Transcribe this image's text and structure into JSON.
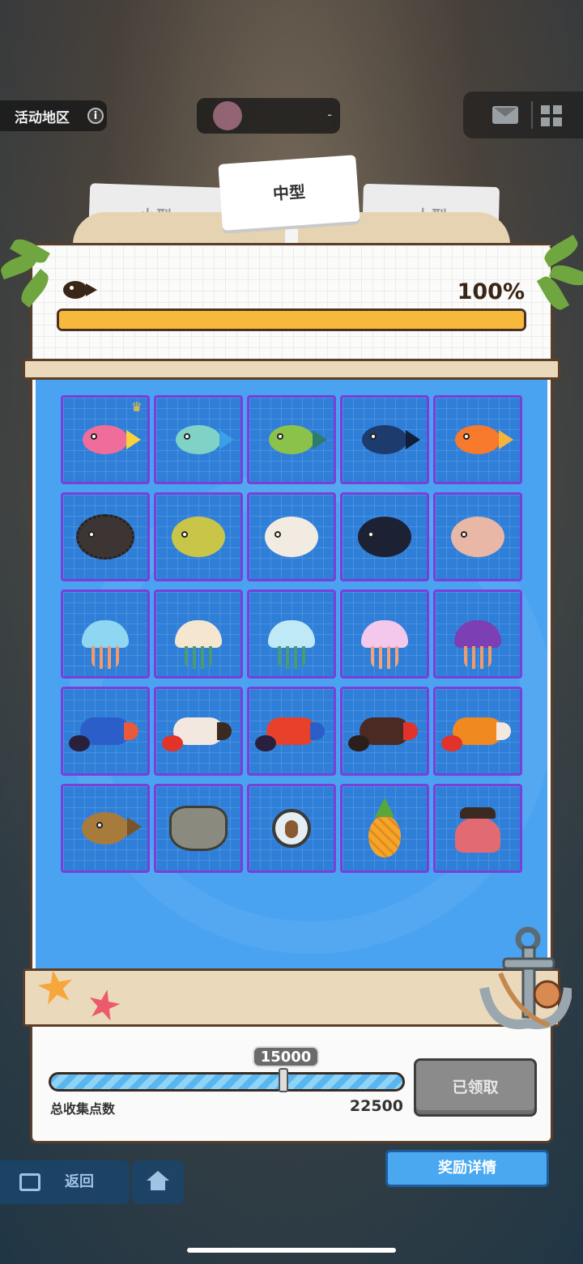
{
  "topbar": {
    "region_label": "活动地区",
    "info_icon": "info-icon",
    "center_value": "-",
    "mail_icon": "mail-icon",
    "menu_icon": "grid-menu-icon"
  },
  "tabs": [
    {
      "label": "小型",
      "selected": false
    },
    {
      "label": "中型",
      "selected": true
    },
    {
      "label": "大型",
      "selected": false
    }
  ],
  "collection": {
    "fish_icon": "fish-icon",
    "percent_text": "100%",
    "progress_fraction": 1.0
  },
  "creatures": [
    {
      "name": "pink-yellow-fish",
      "crown": true
    },
    {
      "name": "teal-orange-fish",
      "crown": false
    },
    {
      "name": "green-fish",
      "crown": false
    },
    {
      "name": "dark-blue-fish",
      "crown": false
    },
    {
      "name": "orange-goldfish",
      "crown": false
    },
    {
      "name": "dark-spiky-puffer",
      "crown": false
    },
    {
      "name": "yellow-spotted-puffer",
      "crown": false
    },
    {
      "name": "white-spotted-puffer",
      "crown": false
    },
    {
      "name": "black-spotted-puffer",
      "crown": false
    },
    {
      "name": "pink-puffer",
      "crown": false
    },
    {
      "name": "blue-jellyfish",
      "crown": false
    },
    {
      "name": "cream-jellyfish",
      "crown": false
    },
    {
      "name": "light-blue-jellyfish",
      "crown": false
    },
    {
      "name": "pink-jellyfish",
      "crown": false
    },
    {
      "name": "purple-jellyfish",
      "crown": false
    },
    {
      "name": "blue-lobster",
      "crown": false
    },
    {
      "name": "red-white-lobster",
      "crown": false
    },
    {
      "name": "red-lobster",
      "crown": false
    },
    {
      "name": "dark-lobster",
      "crown": false
    },
    {
      "name": "orange-lobster",
      "crown": false
    },
    {
      "name": "anglerfish",
      "crown": false
    },
    {
      "name": "armored-crab",
      "crown": false
    },
    {
      "name": "squirrel-badge",
      "crown": false
    },
    {
      "name": "pineapple",
      "crown": false
    },
    {
      "name": "pirate-octopus",
      "crown": false
    }
  ],
  "reward": {
    "milestone": "15000",
    "progress_fraction": 0.66,
    "total_label": "总收集点数",
    "total_value": "22500",
    "claim_label": "已领取",
    "star_icon": "star-icon"
  },
  "bottom": {
    "details_label": "奖励详情",
    "back_label": "返回",
    "back_icon": "exit-icon",
    "home_icon": "home-icon"
  },
  "colors": {
    "panel_water": "#4aa3f1",
    "cell_border": "#7a3fd8",
    "progress_fill": "#f7b93b",
    "details_button": "#4aa8f1"
  }
}
